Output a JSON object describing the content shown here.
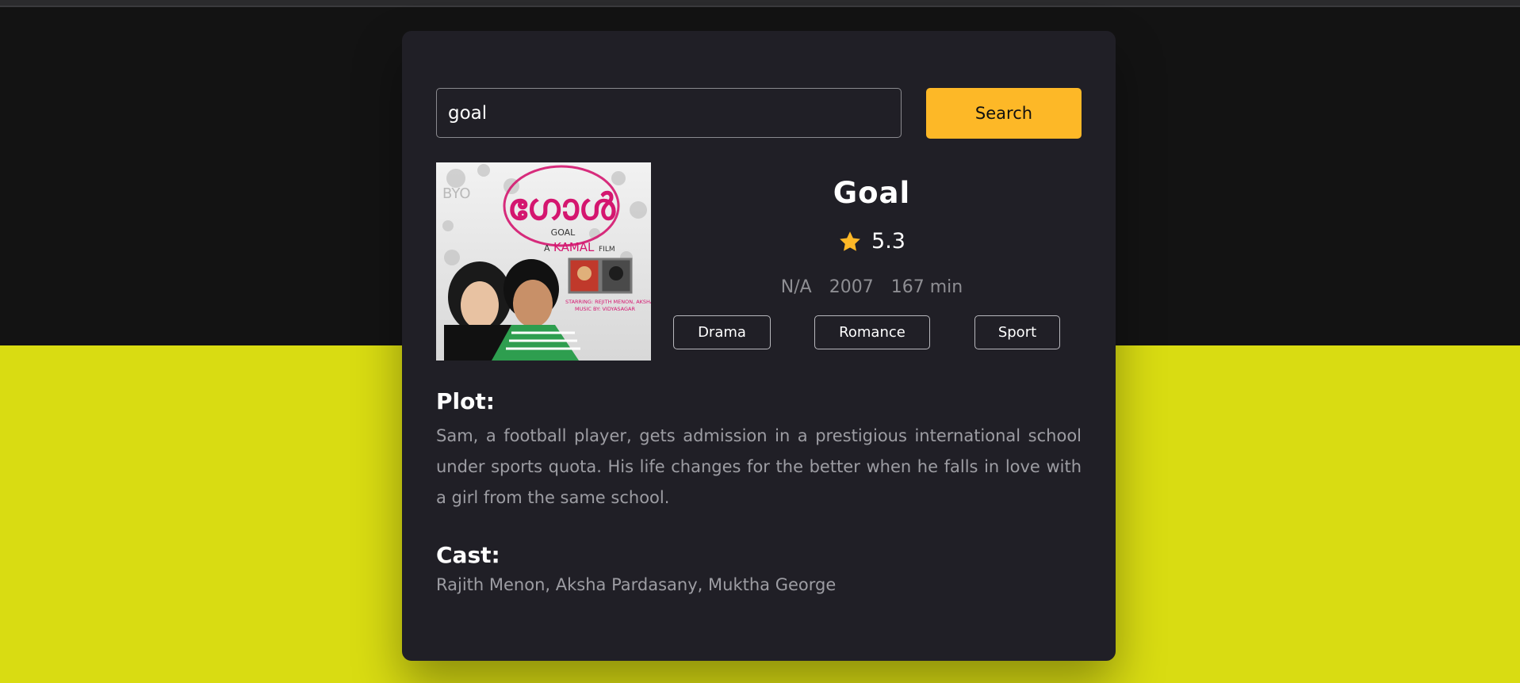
{
  "search": {
    "value": "goal",
    "button_label": "Search"
  },
  "movie": {
    "title": "Goal",
    "rating": "5.3",
    "rated": "N/A",
    "year": "2007",
    "runtime": "167 min",
    "genres": [
      "Drama",
      "Romance",
      "Sport"
    ],
    "plot_heading": "Plot:",
    "plot": "Sam, a football player, gets admission in a prestigious international school under sports quota. His life changes for the better when he falls in love with a girl from the same school.",
    "cast_heading": "Cast:",
    "cast": "Rajith Menon, Aksha Pardasany, Muktha George"
  },
  "poster": {
    "title_malayalam": "ഗോൾ",
    "title_latin": "GOAL",
    "tagline_prefix": "A",
    "director": "KAMAL",
    "tagline_suffix": "FILM",
    "starring": "STARRING: REJITH MENON, AKSHA",
    "music": "MUSIC BY: VIDYASAGAR"
  },
  "colors": {
    "accent": "#fdb827",
    "card": "#201f26",
    "background_top": "#131313",
    "background_bottom": "#d9dc12",
    "poster_magenta": "#d4166f"
  },
  "icons": {
    "rating": "star-icon"
  }
}
